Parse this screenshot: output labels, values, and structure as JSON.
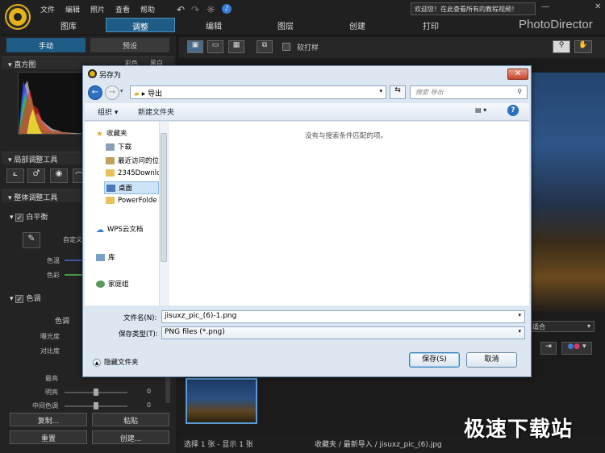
{
  "menu": [
    "文件",
    "编辑",
    "照片",
    "查看",
    "帮助"
  ],
  "welcome": "欢迎您！在此查看所有的教程视频！",
  "window_controls": {
    "minimize": "—",
    "close": "✕"
  },
  "modes": [
    "图库",
    "调整",
    "编辑",
    "图层",
    "创建",
    "打印"
  ],
  "active_mode": "调整",
  "brand": "PhotoDirector",
  "left": {
    "tabs": [
      "手动",
      "预设"
    ],
    "histogram_title": "直方图",
    "histogram_extra": [
      "彩色",
      "黑白"
    ],
    "local_tools_title": "局部调整工具",
    "global_tools_title": "整体调整工具",
    "white_balance": "白平衡",
    "custom": "自定义",
    "temp": "色温",
    "tint": "色彩",
    "tone": "色调",
    "tone_label": "色调",
    "exposure": "曝光度",
    "contrast": "对比度",
    "highlight": "最亮",
    "brightness": "明亮",
    "midtone": "中间色调",
    "zero": "0",
    "copy": "复制...",
    "paste": "粘贴",
    "reset": "重置",
    "create": "创建..."
  },
  "viewer": {
    "softproof": "软打样",
    "fit": "适合"
  },
  "status": {
    "selection": "选择 1 张 - 显示 1 张",
    "path": "收藏夹 / 最新导入 / jisuxz_pic_(6).jpg"
  },
  "watermark": "极速下载站",
  "dialog": {
    "title": "另存为",
    "close": "✕",
    "address": "导出",
    "search_placeholder": "搜索 导出",
    "organize": "组织 ▾",
    "new_folder": "新建文件夹",
    "nav": [
      {
        "label": "收藏夹",
        "icon": "star-icon"
      },
      {
        "label": "下载",
        "icon": "download-folder-icon"
      },
      {
        "label": "最近访问的位",
        "icon": "recent-icon"
      },
      {
        "label": "2345Downlo",
        "icon": "folder-icon"
      },
      {
        "label": "桌面",
        "icon": "desktop-icon"
      },
      {
        "label": "PowerFolde",
        "icon": "folder-icon"
      },
      {
        "label": "WPS云文档",
        "icon": "cloud-icon"
      },
      {
        "label": "库",
        "icon": "library-icon"
      },
      {
        "label": "家庭组",
        "icon": "homegroup-icon"
      }
    ],
    "empty_message": "没有与搜索条件匹配的项。",
    "filename_label": "文件名(N):",
    "filename_value": "jisuxz_pic_(6)-1.png",
    "filetype_label": "保存类型(T):",
    "filetype_value": "PNG files (*.png)",
    "hide_folders": "隐藏文件夹",
    "save": "保存(S)",
    "cancel": "取消"
  }
}
